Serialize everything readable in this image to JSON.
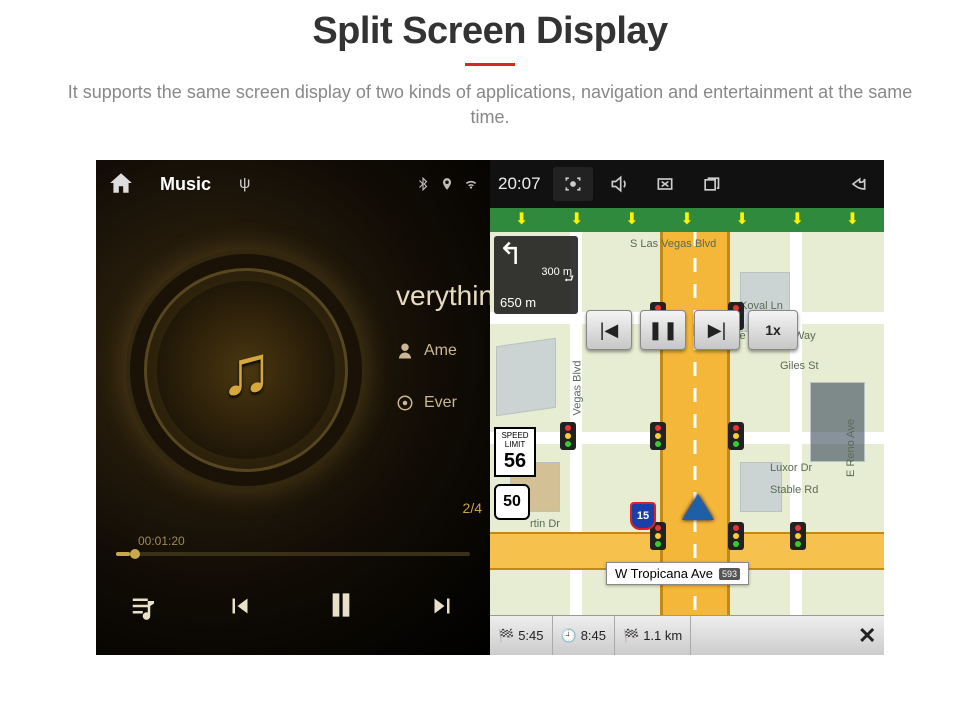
{
  "header": {
    "title": "Split Screen Display",
    "subtitle": "It supports the same screen display of two kinds of applications, navigation and entertainment at the same time."
  },
  "music": {
    "app_label": "Music",
    "status_time": "20:07",
    "now_playing_title": "verythin",
    "artist": "Ame",
    "album": "Ever",
    "track_index": "2/4",
    "elapsed": "00:01:20"
  },
  "nav": {
    "clock": "20:07",
    "turn": {
      "dist1": "300 m",
      "dist2": "650 m"
    },
    "speed_button": "1x",
    "streets": {
      "top": "S Las Vegas Blvd",
      "koval": "Koval Ln",
      "duke": "Duke Ellington Way",
      "giles": "Giles St",
      "vegas2": "Vegas Blvd",
      "luxor": "Luxor Dr",
      "stable": "Stable Rd",
      "reno": "E Reno Ave",
      "martin": "rtin Dr",
      "tropicana": "W Tropicana Ave",
      "trop_tag": "593"
    },
    "speed_limit": {
      "label": "SPEED LIMIT",
      "value": "56"
    },
    "route_shield": "50",
    "hwy_shield": "15",
    "bottom": {
      "eta": "5:45",
      "clock_small": "8:45",
      "dist": "1.1 km"
    }
  }
}
